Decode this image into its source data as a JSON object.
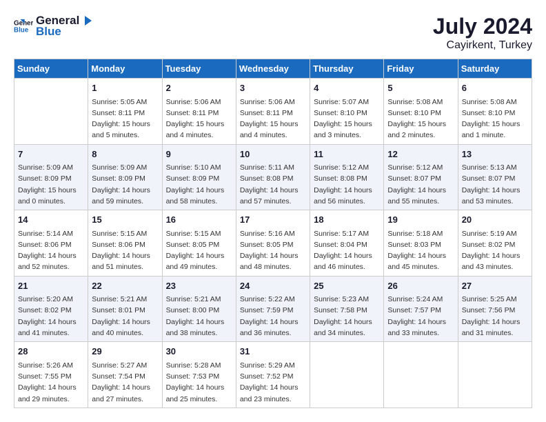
{
  "header": {
    "logo_line1": "General",
    "logo_line2": "Blue",
    "title": "July 2024",
    "subtitle": "Cayirkent, Turkey"
  },
  "days_of_week": [
    "Sunday",
    "Monday",
    "Tuesday",
    "Wednesday",
    "Thursday",
    "Friday",
    "Saturday"
  ],
  "weeks": [
    [
      {
        "day": "",
        "info": ""
      },
      {
        "day": "1",
        "info": "Sunrise: 5:05 AM\nSunset: 8:11 PM\nDaylight: 15 hours\nand 5 minutes."
      },
      {
        "day": "2",
        "info": "Sunrise: 5:06 AM\nSunset: 8:11 PM\nDaylight: 15 hours\nand 4 minutes."
      },
      {
        "day": "3",
        "info": "Sunrise: 5:06 AM\nSunset: 8:11 PM\nDaylight: 15 hours\nand 4 minutes."
      },
      {
        "day": "4",
        "info": "Sunrise: 5:07 AM\nSunset: 8:10 PM\nDaylight: 15 hours\nand 3 minutes."
      },
      {
        "day": "5",
        "info": "Sunrise: 5:08 AM\nSunset: 8:10 PM\nDaylight: 15 hours\nand 2 minutes."
      },
      {
        "day": "6",
        "info": "Sunrise: 5:08 AM\nSunset: 8:10 PM\nDaylight: 15 hours\nand 1 minute."
      }
    ],
    [
      {
        "day": "7",
        "info": "Sunrise: 5:09 AM\nSunset: 8:09 PM\nDaylight: 15 hours\nand 0 minutes."
      },
      {
        "day": "8",
        "info": "Sunrise: 5:09 AM\nSunset: 8:09 PM\nDaylight: 14 hours\nand 59 minutes."
      },
      {
        "day": "9",
        "info": "Sunrise: 5:10 AM\nSunset: 8:09 PM\nDaylight: 14 hours\nand 58 minutes."
      },
      {
        "day": "10",
        "info": "Sunrise: 5:11 AM\nSunset: 8:08 PM\nDaylight: 14 hours\nand 57 minutes."
      },
      {
        "day": "11",
        "info": "Sunrise: 5:12 AM\nSunset: 8:08 PM\nDaylight: 14 hours\nand 56 minutes."
      },
      {
        "day": "12",
        "info": "Sunrise: 5:12 AM\nSunset: 8:07 PM\nDaylight: 14 hours\nand 55 minutes."
      },
      {
        "day": "13",
        "info": "Sunrise: 5:13 AM\nSunset: 8:07 PM\nDaylight: 14 hours\nand 53 minutes."
      }
    ],
    [
      {
        "day": "14",
        "info": "Sunrise: 5:14 AM\nSunset: 8:06 PM\nDaylight: 14 hours\nand 52 minutes."
      },
      {
        "day": "15",
        "info": "Sunrise: 5:15 AM\nSunset: 8:06 PM\nDaylight: 14 hours\nand 51 minutes."
      },
      {
        "day": "16",
        "info": "Sunrise: 5:15 AM\nSunset: 8:05 PM\nDaylight: 14 hours\nand 49 minutes."
      },
      {
        "day": "17",
        "info": "Sunrise: 5:16 AM\nSunset: 8:05 PM\nDaylight: 14 hours\nand 48 minutes."
      },
      {
        "day": "18",
        "info": "Sunrise: 5:17 AM\nSunset: 8:04 PM\nDaylight: 14 hours\nand 46 minutes."
      },
      {
        "day": "19",
        "info": "Sunrise: 5:18 AM\nSunset: 8:03 PM\nDaylight: 14 hours\nand 45 minutes."
      },
      {
        "day": "20",
        "info": "Sunrise: 5:19 AM\nSunset: 8:02 PM\nDaylight: 14 hours\nand 43 minutes."
      }
    ],
    [
      {
        "day": "21",
        "info": "Sunrise: 5:20 AM\nSunset: 8:02 PM\nDaylight: 14 hours\nand 41 minutes."
      },
      {
        "day": "22",
        "info": "Sunrise: 5:21 AM\nSunset: 8:01 PM\nDaylight: 14 hours\nand 40 minutes."
      },
      {
        "day": "23",
        "info": "Sunrise: 5:21 AM\nSunset: 8:00 PM\nDaylight: 14 hours\nand 38 minutes."
      },
      {
        "day": "24",
        "info": "Sunrise: 5:22 AM\nSunset: 7:59 PM\nDaylight: 14 hours\nand 36 minutes."
      },
      {
        "day": "25",
        "info": "Sunrise: 5:23 AM\nSunset: 7:58 PM\nDaylight: 14 hours\nand 34 minutes."
      },
      {
        "day": "26",
        "info": "Sunrise: 5:24 AM\nSunset: 7:57 PM\nDaylight: 14 hours\nand 33 minutes."
      },
      {
        "day": "27",
        "info": "Sunrise: 5:25 AM\nSunset: 7:56 PM\nDaylight: 14 hours\nand 31 minutes."
      }
    ],
    [
      {
        "day": "28",
        "info": "Sunrise: 5:26 AM\nSunset: 7:55 PM\nDaylight: 14 hours\nand 29 minutes."
      },
      {
        "day": "29",
        "info": "Sunrise: 5:27 AM\nSunset: 7:54 PM\nDaylight: 14 hours\nand 27 minutes."
      },
      {
        "day": "30",
        "info": "Sunrise: 5:28 AM\nSunset: 7:53 PM\nDaylight: 14 hours\nand 25 minutes."
      },
      {
        "day": "31",
        "info": "Sunrise: 5:29 AM\nSunset: 7:52 PM\nDaylight: 14 hours\nand 23 minutes."
      },
      {
        "day": "",
        "info": ""
      },
      {
        "day": "",
        "info": ""
      },
      {
        "day": "",
        "info": ""
      }
    ]
  ]
}
